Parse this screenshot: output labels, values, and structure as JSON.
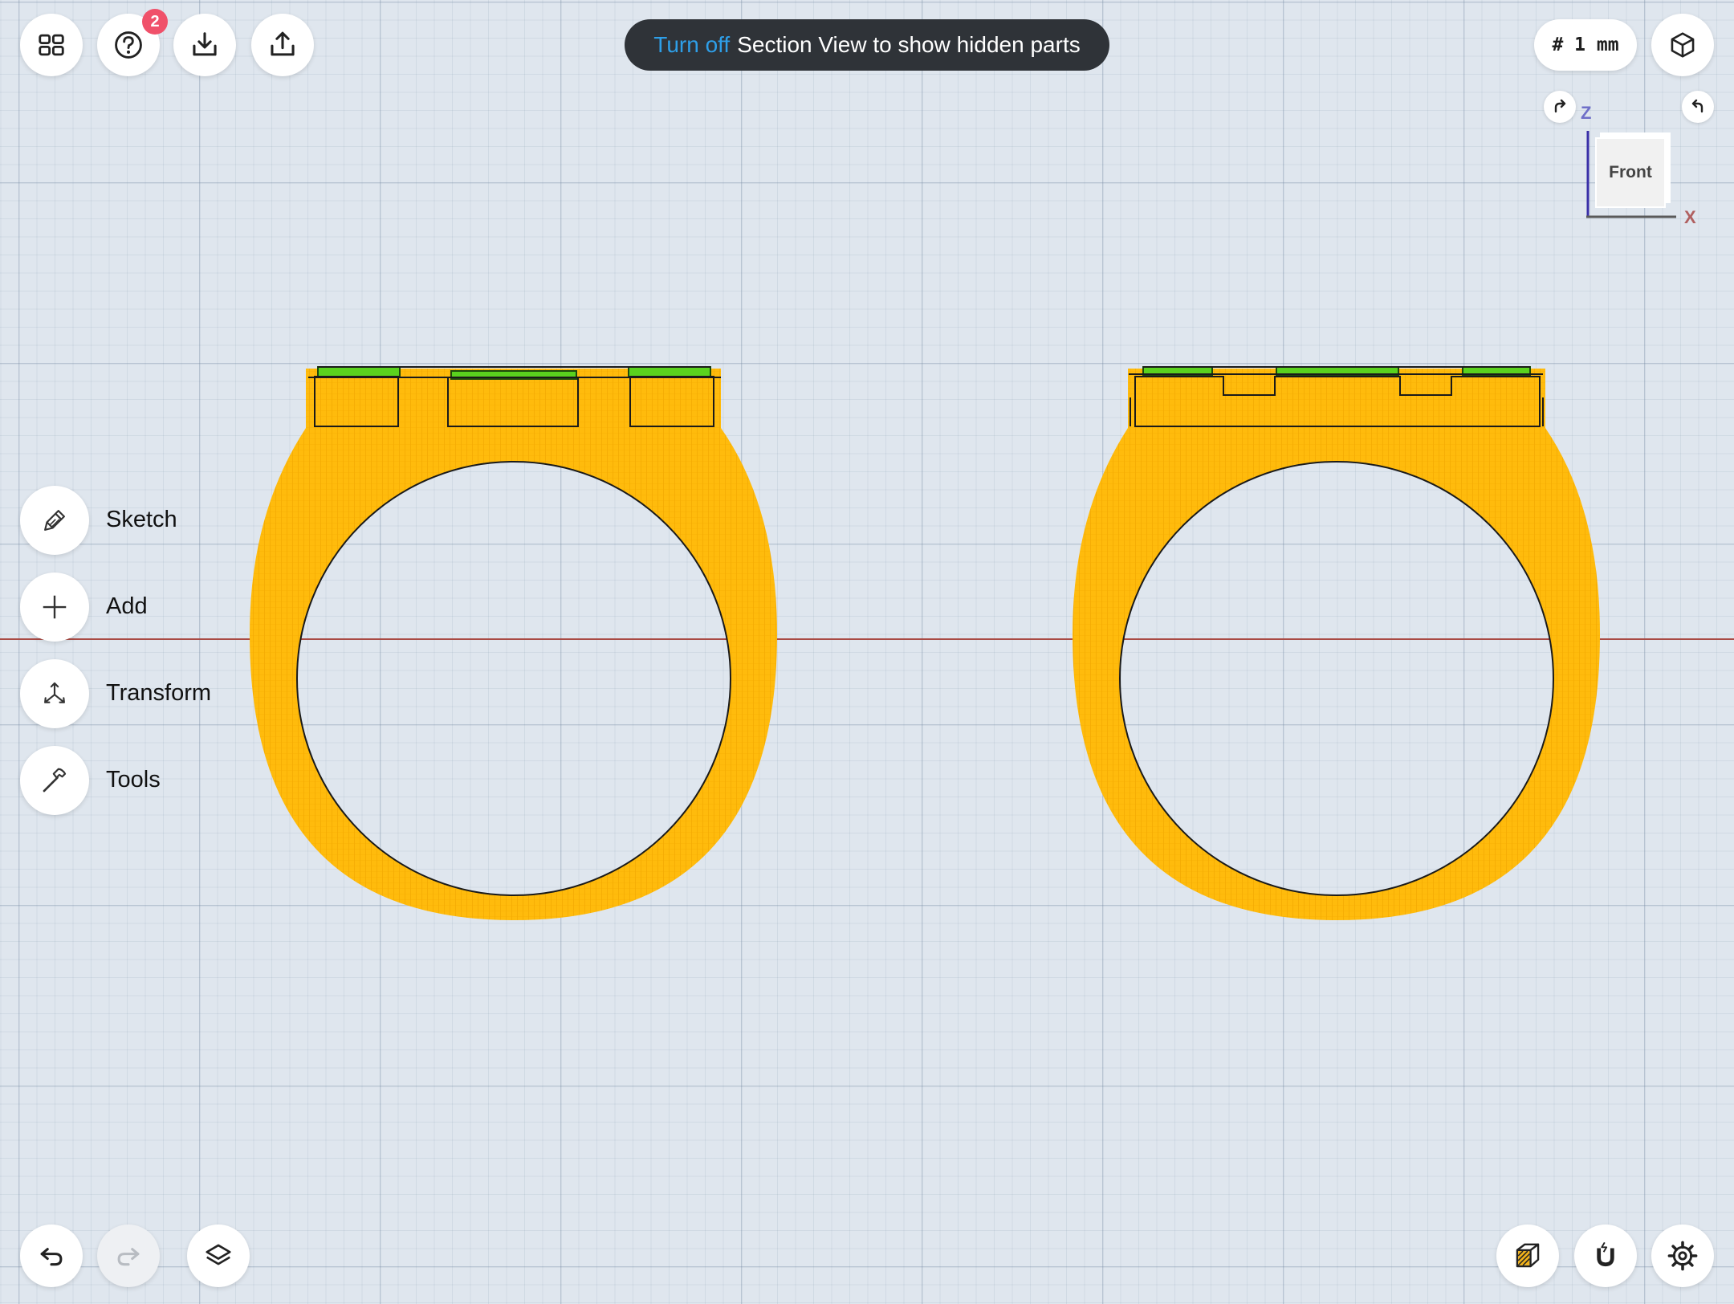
{
  "toolbar_top_left": {
    "apps_icon": "grid-icon",
    "help_icon": "question-icon",
    "help_badge": "2",
    "import_icon": "download-icon",
    "export_icon": "share-icon"
  },
  "toast": {
    "action": "Turn off",
    "message": "Section View to show hidden parts"
  },
  "grid_setting": {
    "label": "# 1 mm"
  },
  "orientation": {
    "face_label": "Front",
    "z_label": "Z",
    "x_label": "X"
  },
  "side_menu": {
    "items": [
      {
        "label": "Sketch",
        "icon": "pencil-icon"
      },
      {
        "label": "Add",
        "icon": "plus-icon"
      },
      {
        "label": "Transform",
        "icon": "transform-arrows-icon"
      },
      {
        "label": "Tools",
        "icon": "hammer-icon"
      }
    ]
  },
  "toolbar_bottom": {
    "undo_icon": "undo-icon",
    "redo_icon": "redo-icon",
    "layers_icon": "layers-icon",
    "section_view_icon": "section-cube-icon",
    "snap_icon": "magnet-icon",
    "settings_icon": "gear-icon"
  },
  "colors": {
    "model_fill": "#ffba0a",
    "inlay_green": "#5ad21e",
    "toast_accent": "#2e9fe8",
    "badge": "#f0516a"
  }
}
